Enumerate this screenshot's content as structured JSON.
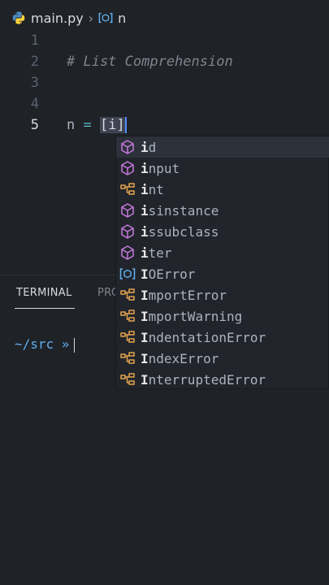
{
  "breadcrumb": {
    "file": "main.py",
    "symbol": "n"
  },
  "editor": {
    "lines": [
      {
        "number": "1",
        "text": ""
      },
      {
        "number": "2",
        "text": "# List Comprehension"
      },
      {
        "number": "3",
        "text": ""
      },
      {
        "number": "4",
        "text": ""
      },
      {
        "number": "5",
        "var": "n",
        "op": "=",
        "open": "[",
        "typed": "i",
        "close": "]"
      }
    ]
  },
  "panel": {
    "terminal_tab": "TERMINAL",
    "problems_tab": "PRC"
  },
  "terminal": {
    "prompt": "~/src »"
  },
  "suggestions": [
    {
      "match": "i",
      "rest": "d",
      "kind": "cube-icon"
    },
    {
      "match": "i",
      "rest": "nput",
      "kind": "cube-icon"
    },
    {
      "match": "i",
      "rest": "nt",
      "kind": "class-icon"
    },
    {
      "match": "i",
      "rest": "sinstance",
      "kind": "cube-icon"
    },
    {
      "match": "i",
      "rest": "ssubclass",
      "kind": "cube-icon"
    },
    {
      "match": "i",
      "rest": "ter",
      "kind": "cube-icon"
    },
    {
      "match": "I",
      "rest": "OError",
      "kind": "variable-icon"
    },
    {
      "match": "I",
      "rest": "mportError",
      "kind": "class-icon"
    },
    {
      "match": "I",
      "rest": "mportWarning",
      "kind": "class-icon"
    },
    {
      "match": "I",
      "rest": "ndentationError",
      "kind": "class-icon"
    },
    {
      "match": "I",
      "rest": "ndexError",
      "kind": "class-icon"
    },
    {
      "match": "I",
      "rest": "nterruptedError",
      "kind": "class-icon"
    }
  ],
  "colors": {
    "background": "#1f2227",
    "cube_icon": "#c678dd",
    "class_icon": "#e5a44f",
    "variable_icon": "#61afef",
    "prompt": "#61afef"
  }
}
